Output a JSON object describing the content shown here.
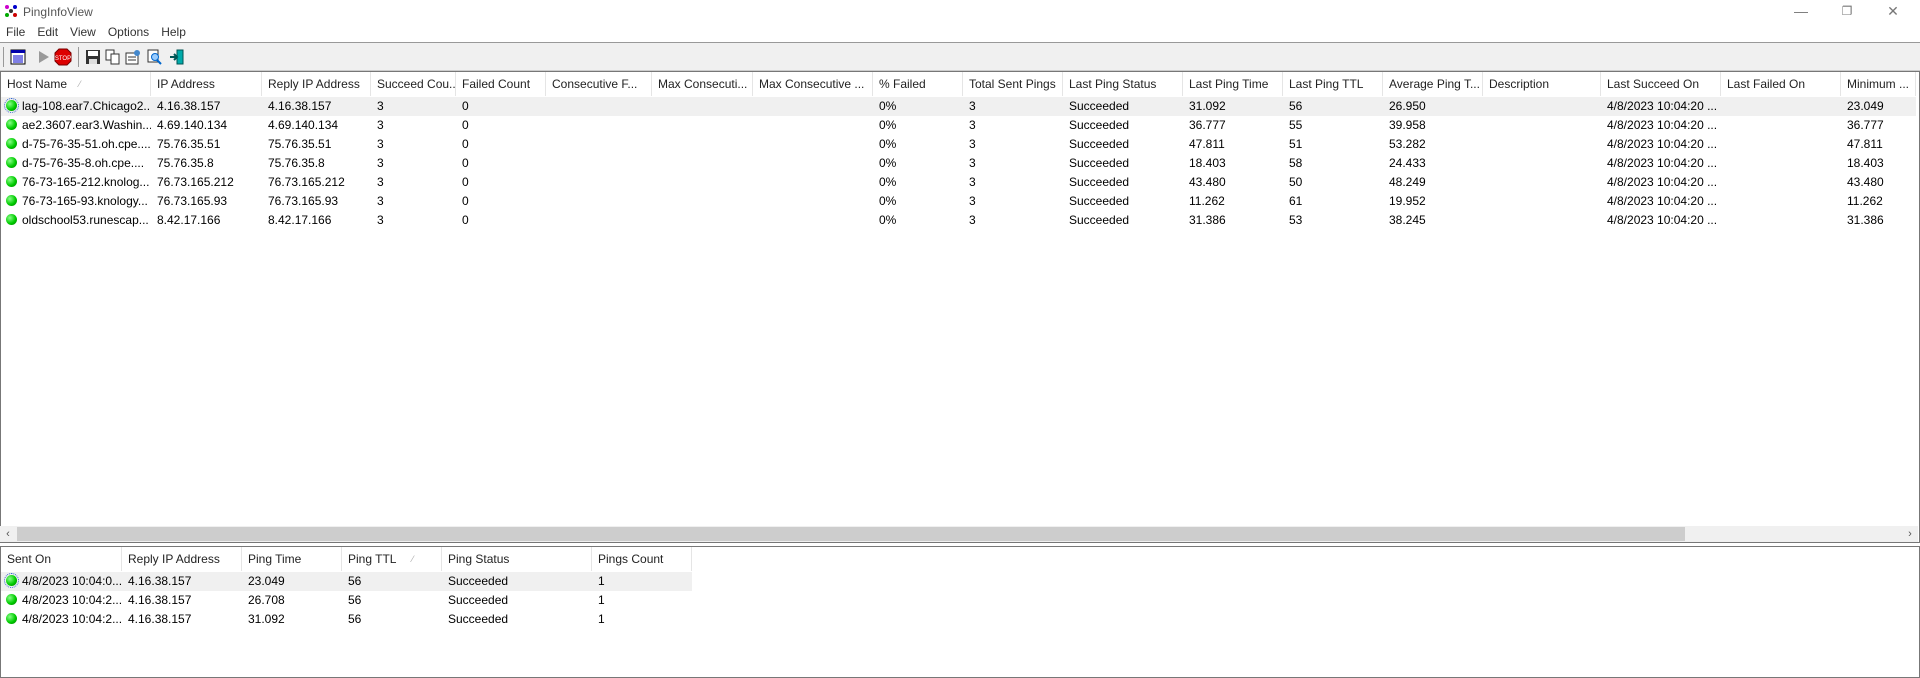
{
  "window": {
    "title": "PingInfoView",
    "minimize": "—",
    "restore": "❐",
    "close": "✕"
  },
  "menu": [
    "File",
    "Edit",
    "View",
    "Options",
    "Help"
  ],
  "toolbar": [
    "ping-options-icon",
    "start-icon",
    "stop-icon",
    "save-icon",
    "copy-icon",
    "properties-icon",
    "find-icon",
    "exit-icon"
  ],
  "main": {
    "columns": [
      "Host Name",
      "IP Address",
      "Reply IP Address",
      "Succeed Cou...",
      "Failed Count",
      "Consecutive F...",
      "Max Consecuti...",
      "Max Consecutive ...",
      "% Failed",
      "Total Sent Pings",
      "Last Ping Status",
      "Last Ping Time",
      "Last Ping TTL",
      "Average Ping T...",
      "Description",
      "Last Succeed On",
      "Last Failed On",
      "Minimum ..."
    ],
    "sort_marker": "⁄",
    "rows": [
      [
        "lag-108.ear7.Chicago2...",
        "4.16.38.157",
        "4.16.38.157",
        "3",
        "0",
        "",
        "",
        "",
        "0%",
        "3",
        "Succeeded",
        "31.092",
        "56",
        "26.950",
        "",
        "4/8/2023 10:04:20 ...",
        "",
        "23.049"
      ],
      [
        "ae2.3607.ear3.Washin...",
        "4.69.140.134",
        "4.69.140.134",
        "3",
        "0",
        "",
        "",
        "",
        "0%",
        "3",
        "Succeeded",
        "36.777",
        "55",
        "39.958",
        "",
        "4/8/2023 10:04:20 ...",
        "",
        "36.777"
      ],
      [
        "d-75-76-35-51.oh.cpe....",
        "75.76.35.51",
        "75.76.35.51",
        "3",
        "0",
        "",
        "",
        "",
        "0%",
        "3",
        "Succeeded",
        "47.811",
        "51",
        "53.282",
        "",
        "4/8/2023 10:04:20 ...",
        "",
        "47.811"
      ],
      [
        "d-75-76-35-8.oh.cpe....",
        "75.76.35.8",
        "75.76.35.8",
        "3",
        "0",
        "",
        "",
        "",
        "0%",
        "3",
        "Succeeded",
        "18.403",
        "58",
        "24.433",
        "",
        "4/8/2023 10:04:20 ...",
        "",
        "18.403"
      ],
      [
        "76-73-165-212.knolog...",
        "76.73.165.212",
        "76.73.165.212",
        "3",
        "0",
        "",
        "",
        "",
        "0%",
        "3",
        "Succeeded",
        "43.480",
        "50",
        "48.249",
        "",
        "4/8/2023 10:04:20 ...",
        "",
        "43.480"
      ],
      [
        "76-73-165-93.knology...",
        "76.73.165.93",
        "76.73.165.93",
        "3",
        "0",
        "",
        "",
        "",
        "0%",
        "3",
        "Succeeded",
        "11.262",
        "61",
        "19.952",
        "",
        "4/8/2023 10:04:20 ...",
        "",
        "11.262"
      ],
      [
        "oldschool53.runescap...",
        "8.42.17.166",
        "8.42.17.166",
        "3",
        "0",
        "",
        "",
        "",
        "0%",
        "3",
        "Succeeded",
        "31.386",
        "53",
        "38.245",
        "",
        "4/8/2023 10:04:20 ...",
        "",
        "31.386"
      ]
    ],
    "scroll_left": "‹",
    "scroll_right": "›"
  },
  "detail": {
    "columns": [
      "Sent On",
      "Reply IP Address",
      "Ping Time",
      "Ping TTL",
      "Ping Status",
      "Pings Count"
    ],
    "rows": [
      [
        "4/8/2023 10:04:0...",
        "4.16.38.157",
        "23.049",
        "56",
        "Succeeded",
        "1"
      ],
      [
        "4/8/2023 10:04:2...",
        "4.16.38.157",
        "26.708",
        "56",
        "Succeeded",
        "1"
      ],
      [
        "4/8/2023 10:04:2...",
        "4.16.38.157",
        "31.092",
        "56",
        "Succeeded",
        "1"
      ]
    ]
  }
}
